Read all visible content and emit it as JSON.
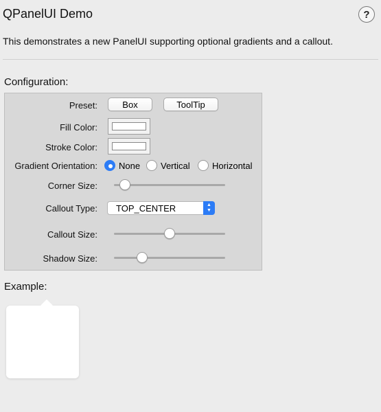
{
  "window": {
    "title": "QPanelUI Demo",
    "help_label": "?",
    "description": "This demonstrates a new PanelUI supporting optional gradients and a callout."
  },
  "configuration": {
    "heading": "Configuration:",
    "preset": {
      "label": "Preset:",
      "buttons": [
        "Box",
        "ToolTip"
      ]
    },
    "fill_color": {
      "label": "Fill Color:",
      "value": "#ffffff"
    },
    "stroke_color": {
      "label": "Stroke Color:",
      "value": "#ffffff"
    },
    "gradient_orientation": {
      "label": "Gradient Orientation:",
      "options": [
        "None",
        "Vertical",
        "Horizontal"
      ],
      "selected": "None"
    },
    "corner_size": {
      "label": "Corner Size:",
      "fraction": 0.1
    },
    "callout_type": {
      "label": "Callout Type:",
      "value": "TOP_CENTER"
    },
    "callout_size": {
      "label": "Callout Size:",
      "fraction": 0.5
    },
    "shadow_size": {
      "label": "Shadow Size:",
      "fraction": 0.25
    }
  },
  "example": {
    "heading": "Example:"
  },
  "colors": {
    "accent": "#2c7cf6",
    "panel_background": "#d8d8d8",
    "window_background": "#ececec"
  }
}
